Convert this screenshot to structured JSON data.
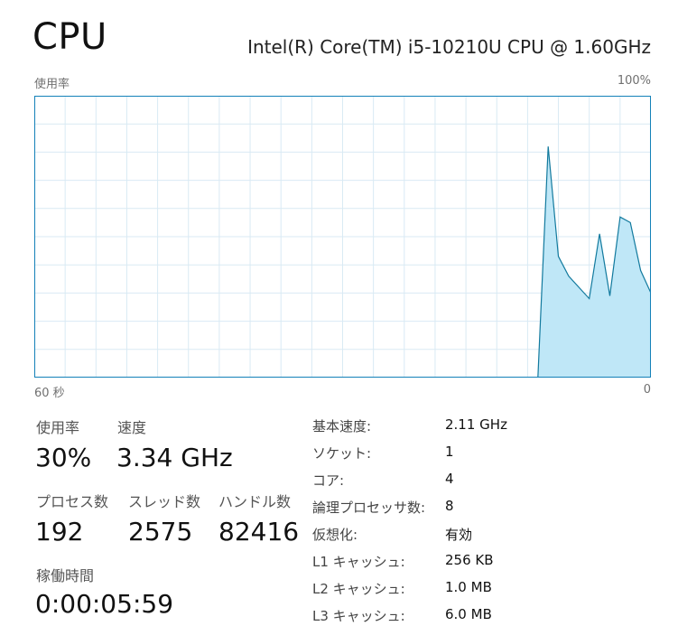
{
  "header": {
    "title": "CPU",
    "cpu_model": "Intel(R) Core(TM) i5-10210U CPU @ 1.60GHz"
  },
  "graph": {
    "y_label": "使用率",
    "y_max_label": "100%",
    "x_left_label": "60 秒",
    "x_right_label": "0",
    "colors": {
      "border": "#1481b8",
      "grid": "#d9eaf4",
      "fill": "#bfe7f7",
      "line": "#127a9e"
    }
  },
  "chart_data": {
    "type": "area",
    "title": "",
    "xlabel": "60 秒",
    "ylabel": "使用率",
    "xlim": [
      60,
      0
    ],
    "ylim": [
      0,
      100
    ],
    "grid": true,
    "x": [
      60,
      11,
      10,
      9,
      8,
      6,
      5,
      4,
      3,
      2,
      1,
      0
    ],
    "series": [
      {
        "values": [
          0,
          0,
          82,
          43,
          36,
          28,
          51,
          29,
          57,
          55,
          38,
          30
        ]
      }
    ]
  },
  "stats": {
    "utilization": {
      "label": "使用率",
      "value": "30%"
    },
    "speed": {
      "label": "速度",
      "value": "3.34 GHz"
    },
    "processes": {
      "label": "プロセス数",
      "value": "192"
    },
    "threads": {
      "label": "スレッド数",
      "value": "2575"
    },
    "handles": {
      "label": "ハンドル数",
      "value": "82416"
    },
    "uptime": {
      "label": "稼働時間",
      "value": "0:00:05:59"
    }
  },
  "specs": {
    "base_speed": {
      "label": "基本速度:",
      "value": "2.11 GHz"
    },
    "sockets": {
      "label": "ソケット:",
      "value": "1"
    },
    "cores": {
      "label": "コア:",
      "value": "4"
    },
    "logical_processors": {
      "label": "論理プロセッサ数:",
      "value": "8"
    },
    "virtualization": {
      "label": "仮想化:",
      "value": "有効"
    },
    "l1_cache": {
      "label": "L1 キャッシュ:",
      "value": "256 KB"
    },
    "l2_cache": {
      "label": "L2 キャッシュ:",
      "value": "1.0 MB"
    },
    "l3_cache": {
      "label": "L3 キャッシュ:",
      "value": "6.0 MB"
    }
  }
}
